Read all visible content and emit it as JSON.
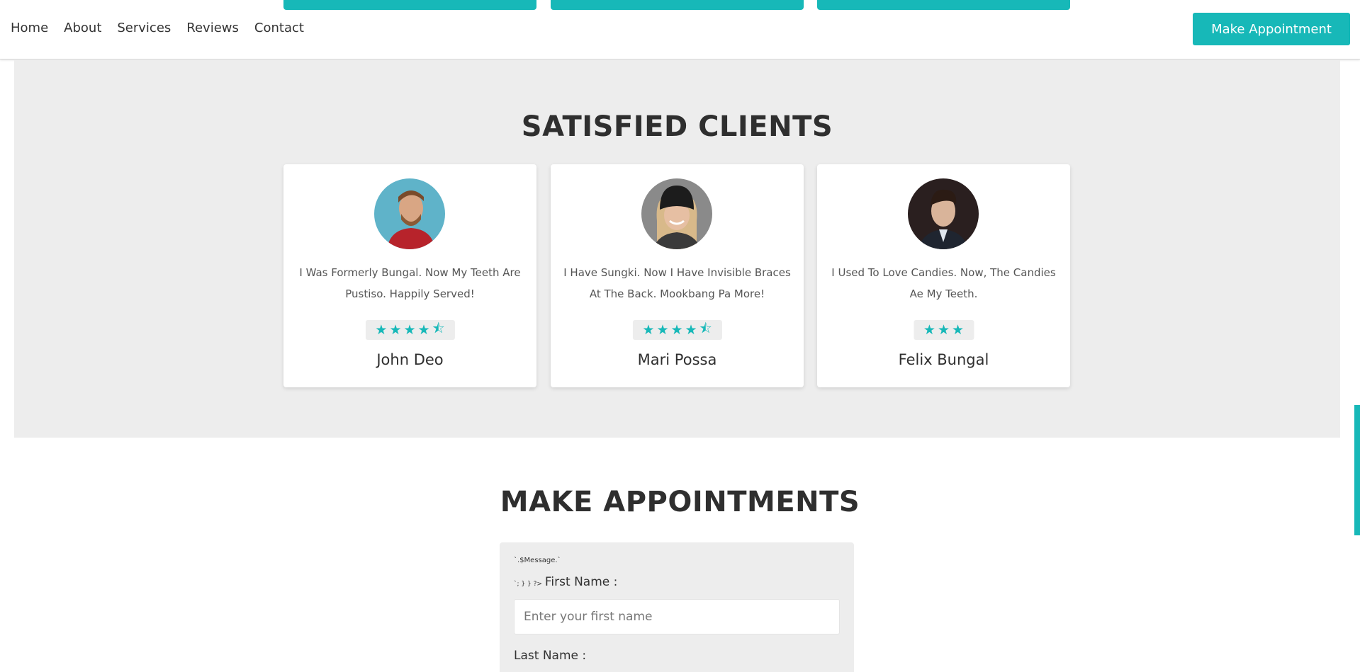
{
  "nav": {
    "links": [
      "Home",
      "About",
      "Services",
      "Reviews",
      "Contact"
    ],
    "cta": "Make Appointment"
  },
  "clients": {
    "title": "SATISFIED CLIENTS",
    "cards": [
      {
        "quote": "I Was Formerly Bungal. Now My Teeth Are Pustiso. Happily Served!",
        "rating": 4.5,
        "name": "John Deo"
      },
      {
        "quote": "I Have Sungki. Now I Have Invisible Braces At The Back. Mookbang Pa More!",
        "rating": 4.5,
        "name": "Mari Possa"
      },
      {
        "quote": "I Used To Love Candies. Now, The Candies Ae My Teeth.",
        "rating": 3,
        "name": "Felix Bungal"
      }
    ]
  },
  "appointment": {
    "title": "MAKE APPOINTMENTS",
    "message": "`.$Message.`",
    "prefix": "`; } } ?>",
    "first_name_label": "First Name :",
    "first_name_placeholder": "Enter your first name",
    "last_name_label": "Last Name :"
  },
  "colors": {
    "accent": "#17b8b8",
    "section_bg": "#ededed"
  }
}
